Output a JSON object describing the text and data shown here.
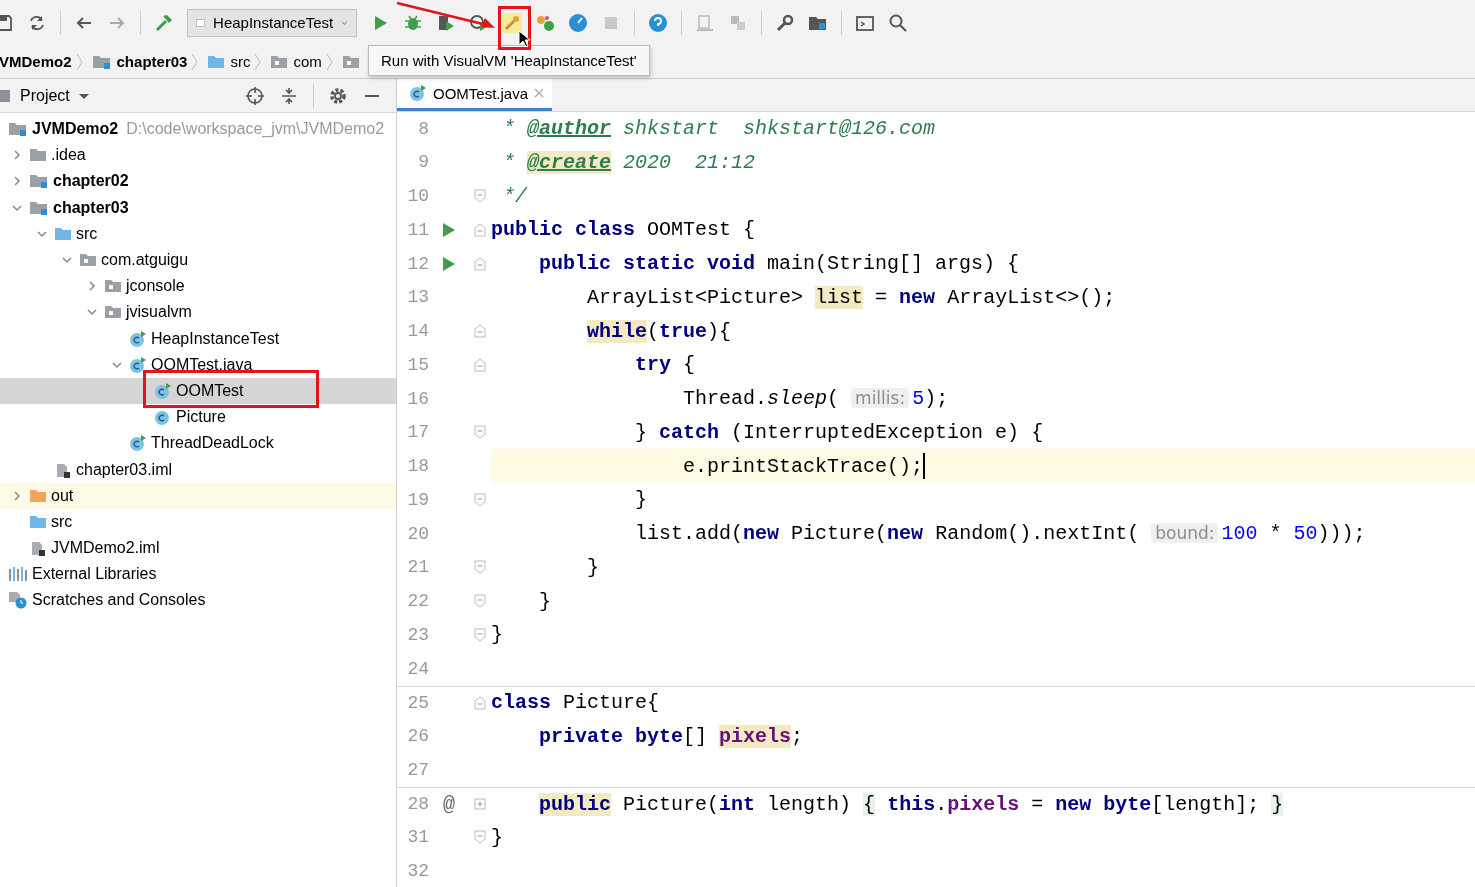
{
  "toolbar": {
    "run_configuration": "HeapInstanceTest",
    "tooltip": "Run with VisualVM 'HeapInstanceTest'"
  },
  "breadcrumb": [
    {
      "text": "VMDemo2",
      "kind": "module"
    },
    {
      "text": "chapter03",
      "kind": "module"
    },
    {
      "text": "src",
      "kind": "source"
    },
    {
      "text": "com",
      "kind": "package"
    },
    {
      "kind": "package"
    }
  ],
  "project_panel": {
    "title": "Project",
    "tree": [
      {
        "text": "JVMDemo2",
        "path": "D:\\code\\workspace_jvm\\JVMDemo2",
        "kind": "module",
        "selected": false,
        "children": [
          {
            "text": ".idea",
            "kind": "folder",
            "expanded": false,
            "selected": false
          },
          {
            "text": "chapter02",
            "kind": "module",
            "expanded": false,
            "selected": false
          },
          {
            "text": "chapter03",
            "kind": "module",
            "expanded": true,
            "selected": false,
            "children": [
              {
                "text": "src",
                "kind": "source",
                "expanded": true,
                "selected": false,
                "children": [
                  {
                    "text": "com.atguigu",
                    "kind": "package",
                    "expanded": true,
                    "selected": false,
                    "children": [
                      {
                        "text": "jconsole",
                        "kind": "package",
                        "expanded": false,
                        "selected": false
                      },
                      {
                        "text": "jvisualvm",
                        "kind": "package",
                        "expanded": true,
                        "selected": false,
                        "children": [
                          {
                            "text": "HeapInstanceTest",
                            "kind": "runclass",
                            "selected": false
                          },
                          {
                            "text": "OOMTest.java",
                            "kind": "runclass",
                            "expanded": true,
                            "selected": false,
                            "children": [
                              {
                                "text": "OOMTest",
                                "kind": "runclass",
                                "selected": true
                              },
                              {
                                "text": "Picture",
                                "kind": "class",
                                "selected": false
                              }
                            ]
                          },
                          {
                            "text": "ThreadDeadLock",
                            "kind": "runclass",
                            "selected": false
                          }
                        ]
                      }
                    ]
                  }
                ]
              },
              {
                "text": "chapter03.iml",
                "kind": "iml",
                "selected": false
              }
            ]
          },
          {
            "text": "out",
            "kind": "excluded",
            "expanded": false,
            "selected": false
          },
          {
            "text": "src",
            "kind": "source",
            "selected": false
          },
          {
            "text": "JVMDemo2.iml",
            "kind": "iml",
            "selected": false
          }
        ]
      },
      {
        "text": "External Libraries",
        "kind": "libraries",
        "selected": false
      },
      {
        "text": "Scratches and Consoles",
        "kind": "scratches",
        "selected": false
      }
    ]
  },
  "editor": {
    "tabs": [
      {
        "title": "OOMTest.java",
        "selected": true
      }
    ],
    "lines": [
      {
        "number": "8",
        "current": false,
        "separator": false,
        "tokens": [
          {
            "kind": "comment",
            "text": " * "
          },
          {
            "kind": "doctag",
            "text": "@author"
          },
          {
            "kind": "comment",
            "text": " shkstart  shkstart@126.com"
          }
        ]
      },
      {
        "number": "9",
        "current": false,
        "separator": false,
        "tokens": [
          {
            "kind": "comment",
            "text": " * "
          },
          {
            "kind": "doctag-usage",
            "text": "@create"
          },
          {
            "kind": "comment",
            "text": " 2020  21:12"
          }
        ]
      },
      {
        "number": "10",
        "fold": {
          "kind": "end"
        },
        "current": false,
        "separator": false,
        "tokens": [
          {
            "kind": "comment",
            "text": " */"
          }
        ]
      },
      {
        "number": "11",
        "gutter": {
          "kind": "run"
        },
        "fold": {
          "kind": "start"
        },
        "current": false,
        "separator": false,
        "tokens": [
          {
            "kind": "keyword",
            "text": "public class"
          },
          {
            "kind": "plain",
            "text": " OOMTest {"
          }
        ]
      },
      {
        "number": "12",
        "gutter": {
          "kind": "run"
        },
        "fold": {
          "kind": "start"
        },
        "current": false,
        "separator": false,
        "tokens": [
          {
            "kind": "keyword",
            "text": "    public static void"
          },
          {
            "kind": "plain",
            "text": " main(String[] args) {"
          }
        ]
      },
      {
        "number": "13",
        "current": false,
        "separator": false,
        "tokens": [
          {
            "kind": "plain",
            "text": "        ArrayList<Picture> "
          },
          {
            "kind": "usage",
            "text": "list"
          },
          {
            "kind": "plain",
            "text": " = "
          },
          {
            "kind": "keyword",
            "text": "new"
          },
          {
            "kind": "plain",
            "text": " ArrayList<>();"
          }
        ]
      },
      {
        "number": "14",
        "fold": {
          "kind": "start"
        },
        "current": false,
        "separator": false,
        "tokens": [
          {
            "kind": "keyword-usage",
            "text": "        while"
          },
          {
            "kind": "plain",
            "text": "("
          },
          {
            "kind": "keyword",
            "text": "true"
          },
          {
            "kind": "plain",
            "text": "){"
          }
        ]
      },
      {
        "number": "15",
        "fold": {
          "kind": "start"
        },
        "current": false,
        "separator": false,
        "tokens": [
          {
            "kind": "keyword",
            "text": "            try"
          },
          {
            "kind": "plain",
            "text": " {"
          }
        ]
      },
      {
        "number": "16",
        "current": false,
        "separator": false,
        "tokens": [
          {
            "kind": "plain",
            "text": "                Thread."
          },
          {
            "kind": "italic",
            "text": "sleep"
          },
          {
            "kind": "plain",
            "text": "( "
          },
          {
            "kind": "hint",
            "text": "millis:"
          },
          {
            "kind": "number",
            "text": "5"
          },
          {
            "kind": "plain",
            "text": ");"
          }
        ]
      },
      {
        "number": "17",
        "fold": {
          "kind": "end"
        },
        "current": false,
        "separator": false,
        "tokens": [
          {
            "kind": "plain",
            "text": "            } "
          },
          {
            "kind": "keyword",
            "text": "catch"
          },
          {
            "kind": "plain",
            "text": " (InterruptedException e) {"
          }
        ]
      },
      {
        "number": "18",
        "current": true,
        "separator": false,
        "tokens": [
          {
            "kind": "plain",
            "text": "                e.printStackTrace();"
          }
        ]
      },
      {
        "number": "19",
        "fold": {
          "kind": "end"
        },
        "current": false,
        "separator": false,
        "tokens": [
          {
            "kind": "plain",
            "text": "            }"
          }
        ]
      },
      {
        "number": "20",
        "current": false,
        "separator": false,
        "tokens": [
          {
            "kind": "plain",
            "text": "            list.add("
          },
          {
            "kind": "keyword",
            "text": "new"
          },
          {
            "kind": "plain",
            "text": " Picture("
          },
          {
            "kind": "keyword",
            "text": "new"
          },
          {
            "kind": "plain",
            "text": " Random().nextInt( "
          },
          {
            "kind": "hint",
            "text": "bound:"
          },
          {
            "kind": "number",
            "text": "100"
          },
          {
            "kind": "plain",
            "text": " * "
          },
          {
            "kind": "number",
            "text": "50"
          },
          {
            "kind": "plain",
            "text": ")));"
          }
        ]
      },
      {
        "number": "21",
        "fold": {
          "kind": "end"
        },
        "current": false,
        "separator": false,
        "tokens": [
          {
            "kind": "plain",
            "text": "        }"
          }
        ]
      },
      {
        "number": "22",
        "fold": {
          "kind": "end"
        },
        "current": false,
        "separator": false,
        "tokens": [
          {
            "kind": "plain",
            "text": "    }"
          }
        ]
      },
      {
        "number": "23",
        "fold": {
          "kind": "end"
        },
        "current": false,
        "separator": false,
        "tokens": [
          {
            "kind": "plain",
            "text": "}"
          }
        ]
      },
      {
        "number": "24",
        "current": false,
        "separator": false
      },
      {
        "number": "25",
        "fold": {
          "kind": "start"
        },
        "current": false,
        "separator": true,
        "tokens": [
          {
            "kind": "keyword",
            "text": "class"
          },
          {
            "kind": "plain",
            "text": " Picture{"
          }
        ]
      },
      {
        "number": "26",
        "current": false,
        "separator": false,
        "tokens": [
          {
            "kind": "keyword",
            "text": "    private byte"
          },
          {
            "kind": "plain",
            "text": "[] "
          },
          {
            "kind": "field-usage",
            "text": "pixels"
          },
          {
            "kind": "plain",
            "text": ";"
          }
        ]
      },
      {
        "number": "27",
        "current": false,
        "separator": false
      },
      {
        "number": "28",
        "gutter": {
          "kind": "override",
          "mark": "@"
        },
        "fold": {
          "kind": "collapsed"
        },
        "current": false,
        "separator": true,
        "tokens": [
          {
            "kind": "keyword-usage",
            "text": "    public"
          },
          {
            "kind": "plain",
            "text": " Picture("
          },
          {
            "kind": "keyword",
            "text": "int"
          },
          {
            "kind": "plain",
            "text": " length) "
          },
          {
            "kind": "folded",
            "text": "{"
          },
          {
            "kind": "keyword",
            "text": " this"
          },
          {
            "kind": "plain",
            "text": "."
          },
          {
            "kind": "field",
            "text": "pixels"
          },
          {
            "kind": "plain",
            "text": " = "
          },
          {
            "kind": "keyword",
            "text": "new byte"
          },
          {
            "kind": "plain",
            "text": "[length]; "
          },
          {
            "kind": "folded",
            "text": "}"
          }
        ]
      },
      {
        "number": "31",
        "fold": {
          "kind": "end"
        },
        "current": false,
        "separator": false,
        "tokens": [
          {
            "kind": "plain",
            "text": "}"
          }
        ]
      },
      {
        "number": "32",
        "current": false,
        "separator": false
      }
    ]
  }
}
